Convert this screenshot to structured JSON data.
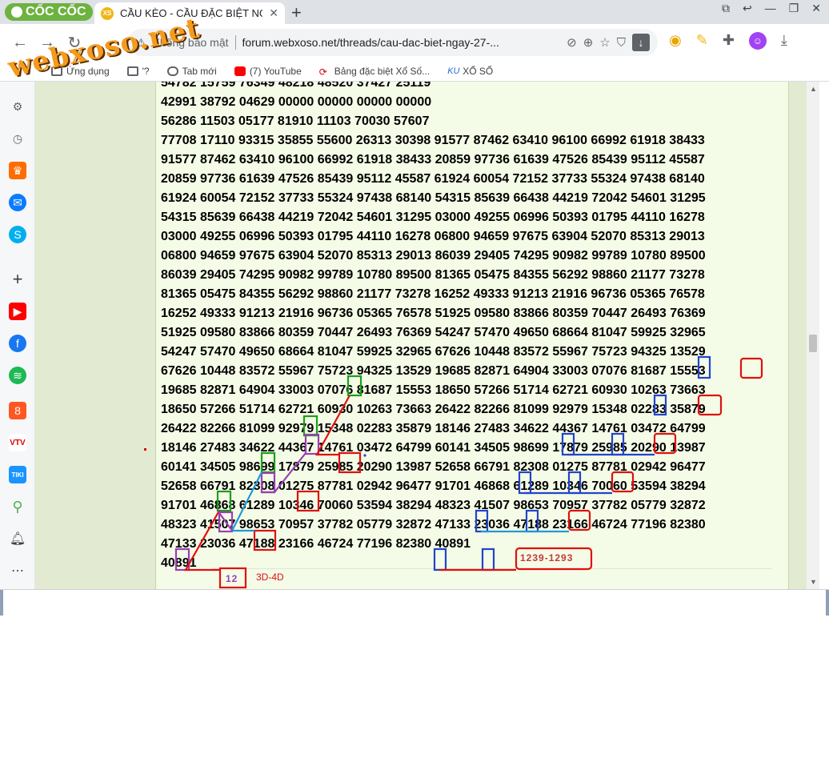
{
  "browser": {
    "brand": "CỐC CỐC",
    "tab_title": "CẦU KÈO - CẦU ĐẶC BIỆT NG",
    "tab_favicon": "XS",
    "security_text": "Không bảo mật",
    "url": "forum.webxoso.net/threads/cau-dac-biet-ngay-27-...",
    "avatar_letter": "☺"
  },
  "bookmarks": [
    {
      "icon": "folder-icon",
      "label": "Ứng dụng"
    },
    {
      "icon": "folder-icon",
      "label": "'?"
    },
    {
      "icon": "globe-icon",
      "label": "Tab mới"
    },
    {
      "icon": "youtube-icon",
      "label": "(7) YouTube"
    },
    {
      "icon": "xoso-icon",
      "label": "Bảng đặc biệt Xổ Số..."
    },
    {
      "icon": "ku-icon",
      "label": "XỔ SỐ"
    }
  ],
  "watermark": "webxoso.net",
  "colors": {
    "green": "#1aa01a",
    "blue": "#2244cc",
    "red": "#e01010",
    "purple": "#9a3fb4",
    "cyan": "#1e9ad6"
  },
  "post": {
    "rows": [
      "54782 15759 76349 48218 48520 37427 25119",
      "42991 38792 04629 00000 00000 00000 00000",
      "56286 11503 05177 81910 11103 70030 57607",
      "77708 17110 93315 35855 55600 26313 30398 91577 87462 63410 96100 66992 61918 38433",
      "91577 87462 63410 96100 66992 61918 38433 20859 97736 61639 47526 85439 95112 45587",
      "20859 97736 61639 47526 85439 95112 45587 61924 60054 72152 37733 55324 97438 68140",
      "61924 60054 72152 37733 55324 97438 68140 54315 85639 66438 44219 72042 54601 31295",
      "54315 85639 66438 44219 72042 54601 31295 03000 49255 06996 50393 01795 44110 16278",
      "03000 49255 06996 50393 01795 44110 16278 06800 94659 97675 63904 52070 85313 29013",
      "06800 94659 97675 63904 52070 85313 29013 86039 29405 74295 90982 99789 10780 89500",
      "86039 29405 74295 90982 99789 10780 89500 81365 05475 84355 56292 98860 21177 73278",
      "81365 05475 84355 56292 98860 21177 73278 16252 49333 91213 21916 96736 05365 76578",
      "16252 49333 91213 21916 96736 05365 76578 51925 09580 83866 80359 70447 26493 76369",
      "51925 09580 83866 80359 70447 26493 76369 54247 57470 49650 68664 81047 59925 32965",
      "54247 57470 49650 68664 81047 59925 32965 67626 10448 83572 55967 75723 94325 13529",
      "67626 10448 83572 55967 75723 94325 13529 19685 82871 64904 33003 07076 81687 15553",
      "19685 82871 64904 33003 07076 81687 15553 18650 57266 51714 62721 60930 10263 73663",
      "18650 57266 51714 62721 60930 10263 73663 26422 82266 81099 92979 15348 02283 35879",
      "26422 82266 81099 92979 15348 02283 35879 18146 27483 34622 44367 14761 03472 64799",
      "18146 27483 34622 44367 14761 03472 64799 60141 34505 98699 17879 25985 20290 13987",
      "60141 34505 98699 17879 25985 20290 13987 52658 66791 82308 01275 87781 02942 96477",
      "52658 66791 82308 01275 87781 02942 96477 91701 46868 61289 10346 70060 53594 38294",
      "91701 46868 61289 10346 70060 53594 38294 48323 41507 98653 70957 37782 05779 32872",
      "48323 41507 98653 70957 37782 05779 32872 47133 23036 47188 23166 46724 77196 82380",
      "47133 23036 47188 23166 46724 77196 82380 40891",
      "40891"
    ],
    "annotation_sequence": "1239-1293",
    "annotation_pair": "12",
    "caption": "3D-4D"
  }
}
